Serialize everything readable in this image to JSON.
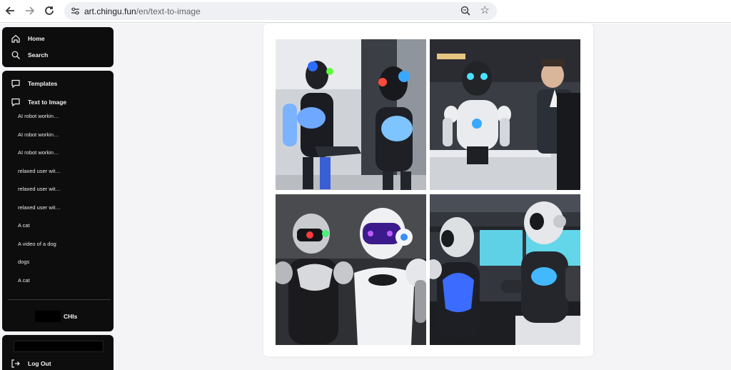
{
  "browser": {
    "url_host": "art.chingu.fun",
    "url_path": "/en/text-to-image",
    "icons": [
      "back-arrow-icon",
      "forward-arrow-icon",
      "reload-icon",
      "site-settings-icon",
      "zoom-icon",
      "bookmark-star-icon"
    ]
  },
  "sidebar": {
    "top": [
      {
        "label": "Home",
        "icon": "home-icon"
      },
      {
        "label": "Search",
        "icon": "search-icon"
      }
    ],
    "sections": [
      {
        "label": "Templates",
        "icon": "chat-bubble-icon"
      },
      {
        "label": "Text to Image",
        "icon": "chat-bubble-icon"
      }
    ],
    "history": [
      "AI robot workin…",
      "AI robot workin…",
      "AI robot workin…",
      "relaxed user wit…",
      "relaxed user wit…",
      "relaxed user wit…",
      "A cat",
      "A video of a dog",
      "dogs",
      "A cat"
    ],
    "credits_label": "CHIs",
    "logout_label": "Log Out"
  },
  "gallery": {
    "images": [
      {
        "subject": "two robots shaking hands"
      },
      {
        "subject": "robot at desk with man"
      },
      {
        "subject": "two white and black robots"
      },
      {
        "subject": "two robots at monitors"
      }
    ]
  },
  "colors": {
    "sidebar_bg": "#0d0d0d",
    "app_bg": "#f4f4f6",
    "accent_blue": "#3a8dff"
  }
}
